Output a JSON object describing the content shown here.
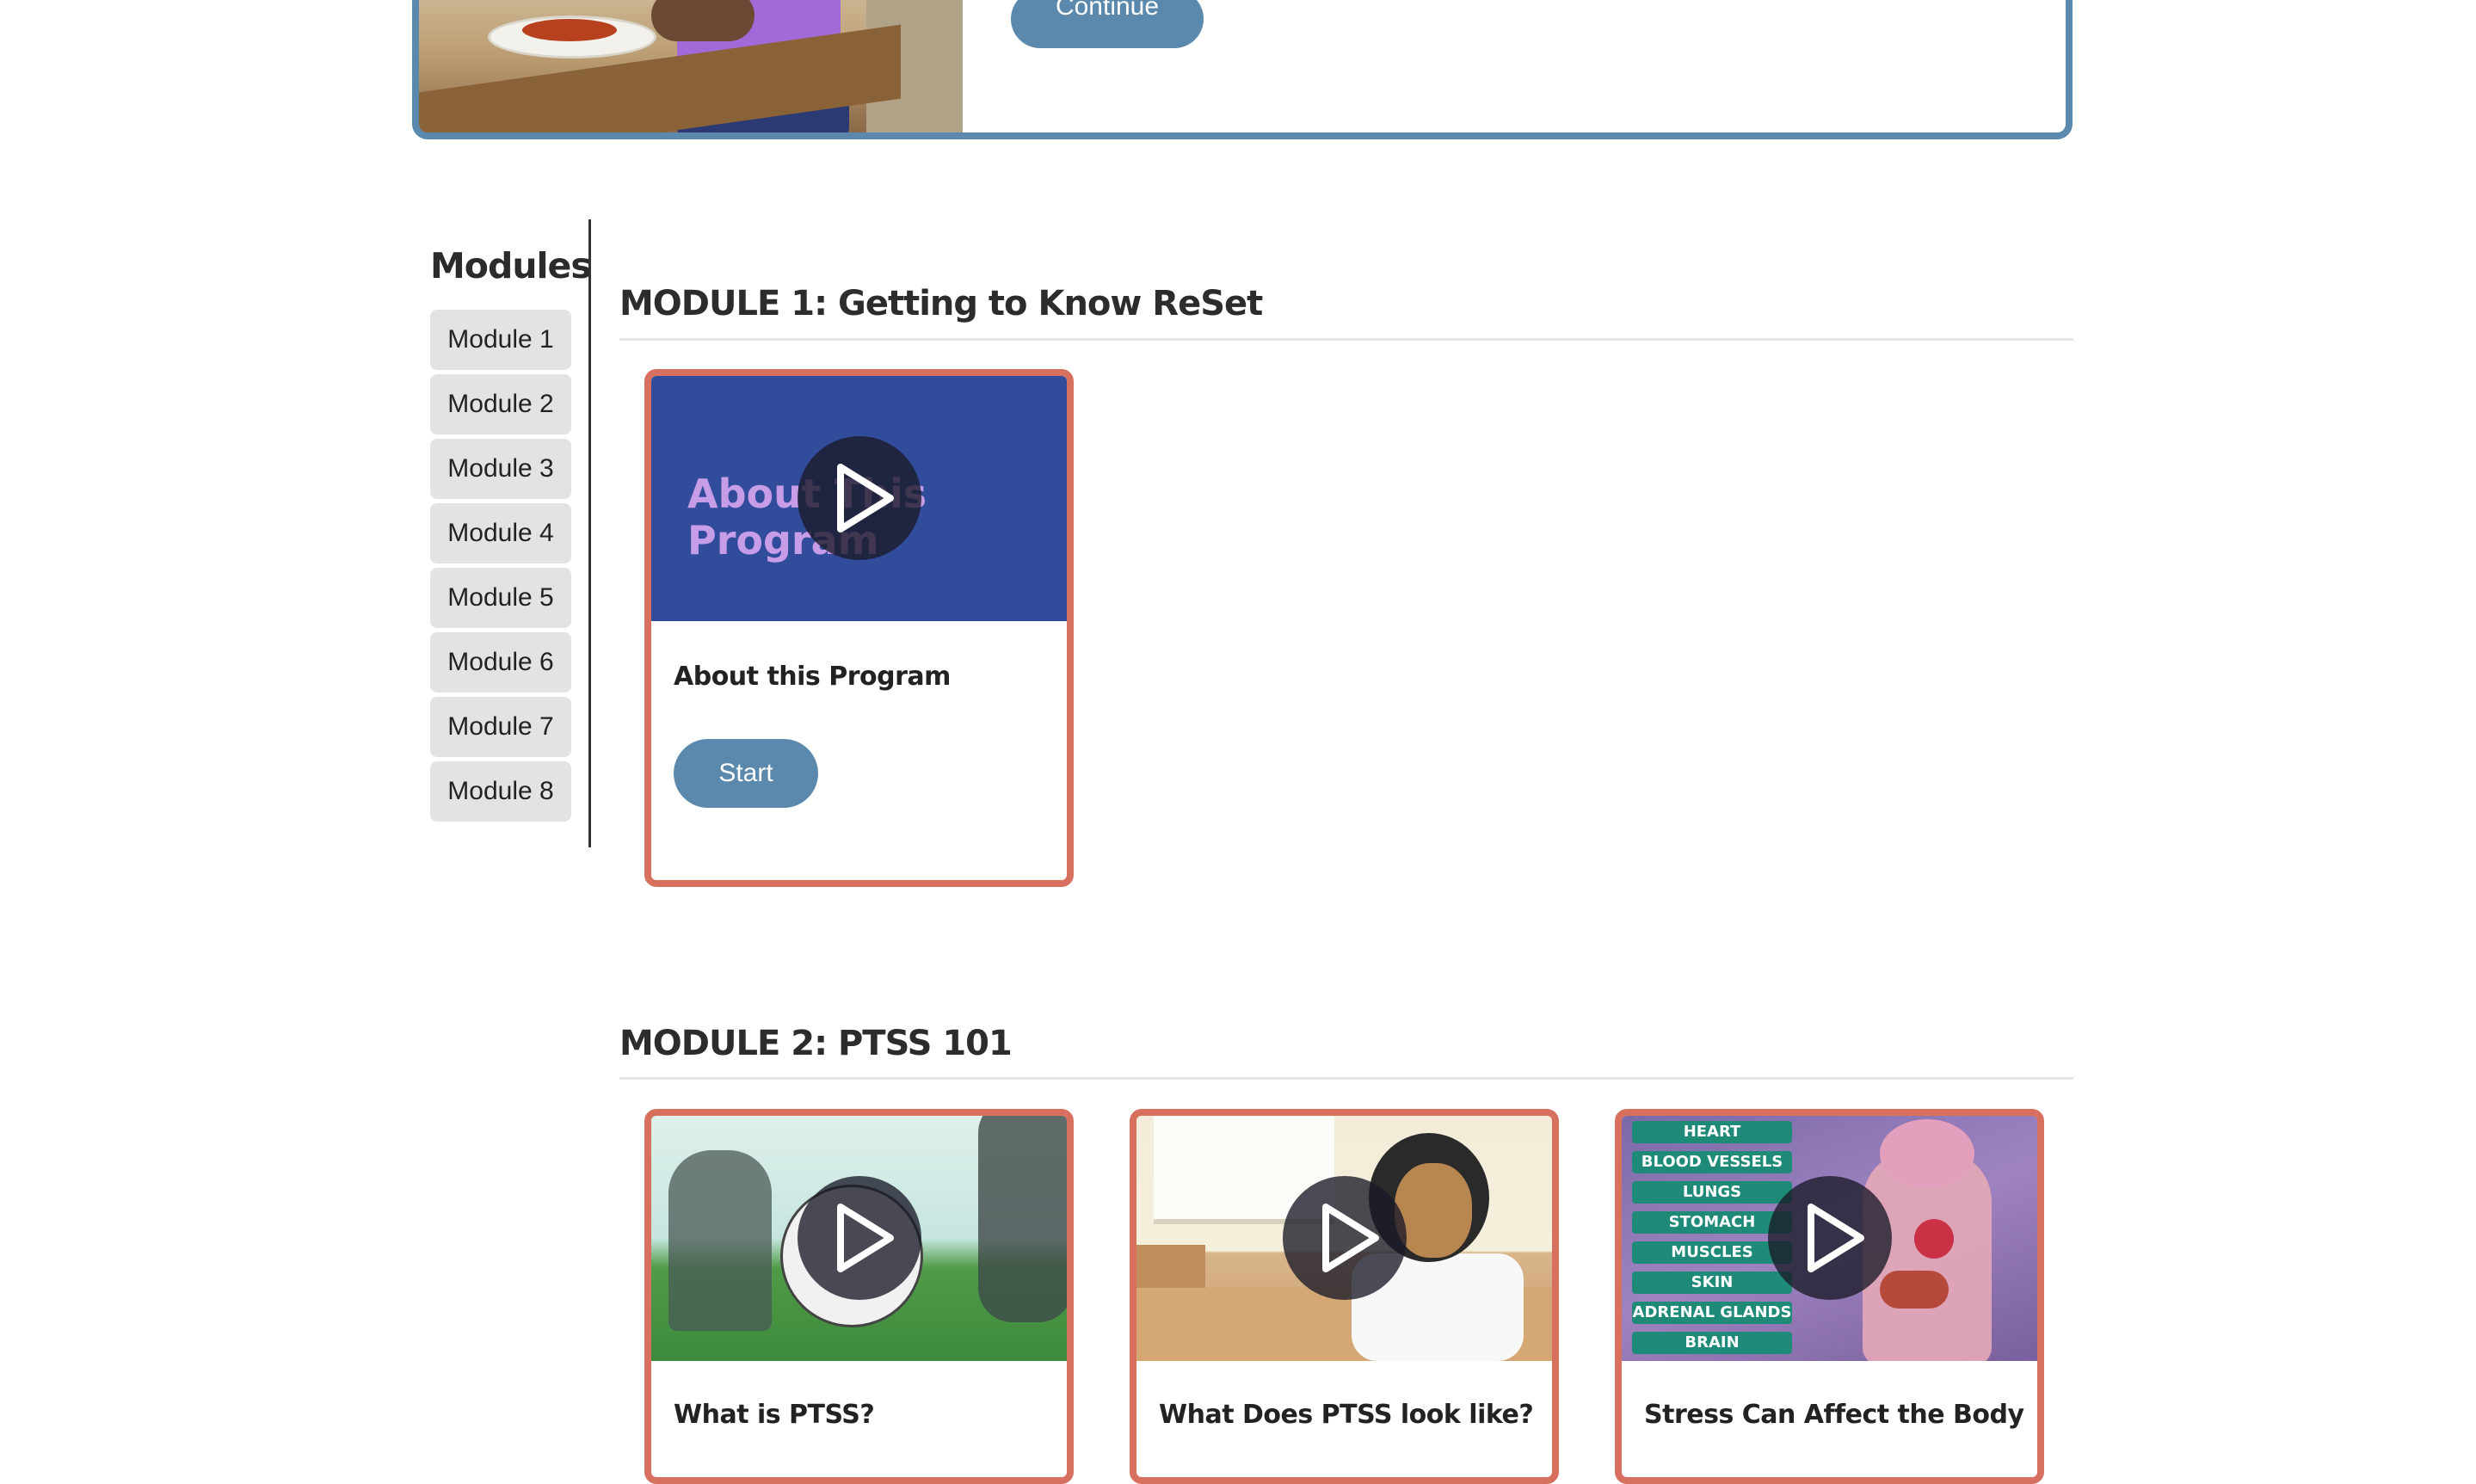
{
  "top_card": {
    "continue_label": "Continue"
  },
  "sidebar": {
    "title": "Modules",
    "items": [
      {
        "label": "Module 1"
      },
      {
        "label": "Module 2"
      },
      {
        "label": "Module 3"
      },
      {
        "label": "Module 4"
      },
      {
        "label": "Module 5"
      },
      {
        "label": "Module 6"
      },
      {
        "label": "Module 7"
      },
      {
        "label": "Module 8"
      }
    ]
  },
  "modules": [
    {
      "title": "MODULE 1: Getting to Know ReSet",
      "cards": [
        {
          "title": "About this Program",
          "thumb_text": "About This Program",
          "button": "Start",
          "icon": "play-icon"
        }
      ]
    },
    {
      "title": "MODULE 2: PTSS 101",
      "cards": [
        {
          "title": "What is PTSS?",
          "icon": "play-icon"
        },
        {
          "title": "What Does PTSS look like?",
          "icon": "play-icon"
        },
        {
          "title": "Stress Can Affect the Body",
          "icon": "play-icon",
          "thumb_labels": [
            "HEART",
            "BLOOD VESSELS",
            "LUNGS",
            "STOMACH",
            "MUSCLES",
            "SKIN",
            "ADRENAL GLANDS",
            "BRAIN"
          ]
        }
      ]
    }
  ],
  "colors": {
    "accent": "#5a89ad",
    "card_border": "#d87060",
    "button_bg": "#e3e3e3"
  }
}
